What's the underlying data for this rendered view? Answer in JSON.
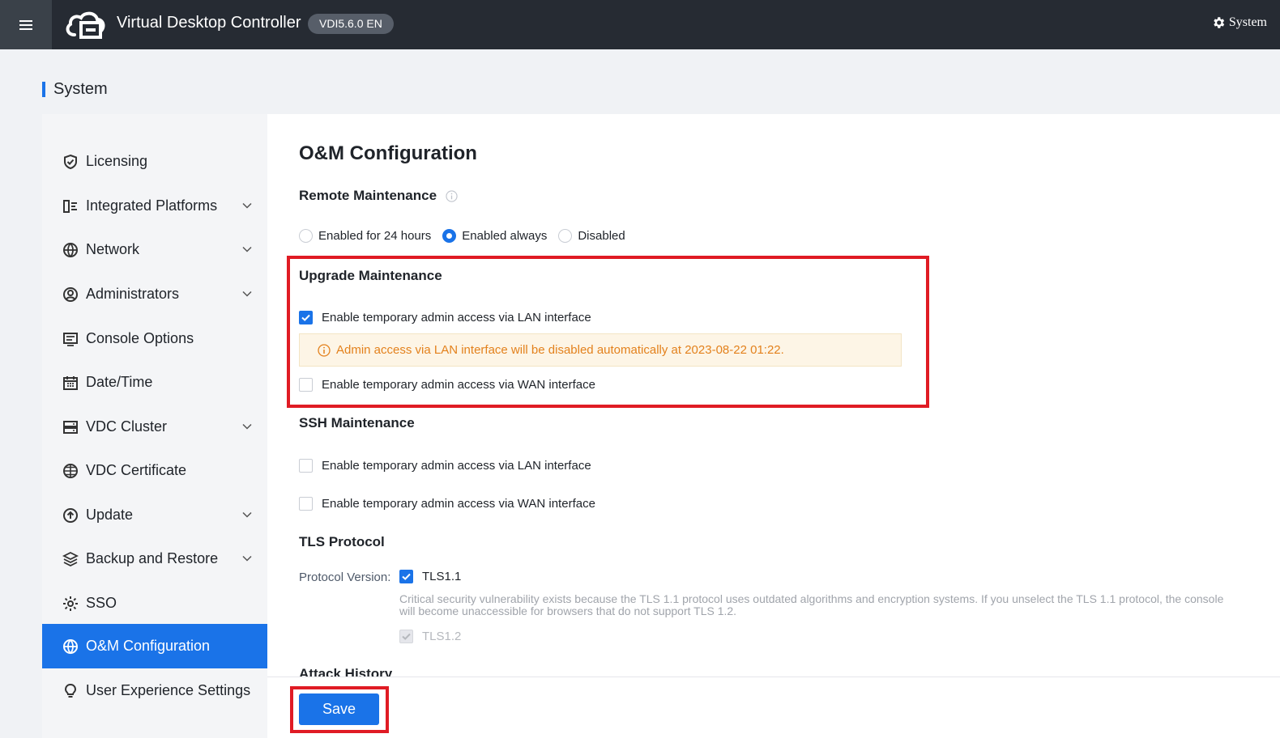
{
  "topbar": {
    "app_title": "Virtual Desktop Controller",
    "version": "VDI5.6.0 EN",
    "system_menu_label": "System"
  },
  "page": {
    "heading": "System",
    "accent_color": "#1a73e8"
  },
  "sidebar": {
    "items": [
      {
        "label": "Licensing",
        "icon": "shield-check-icon",
        "expandable": false
      },
      {
        "label": "Integrated Platforms",
        "icon": "platform-icon",
        "expandable": true
      },
      {
        "label": "Network",
        "icon": "globe-icon",
        "expandable": true
      },
      {
        "label": "Administrators",
        "icon": "user-circle-icon",
        "expandable": true
      },
      {
        "label": "Console Options",
        "icon": "console-icon",
        "expandable": false
      },
      {
        "label": "Date/Time",
        "icon": "calendar-icon",
        "expandable": false
      },
      {
        "label": "VDC Cluster",
        "icon": "server-icon",
        "expandable": true
      },
      {
        "label": "VDC Certificate",
        "icon": "certificate-globe-icon",
        "expandable": false
      },
      {
        "label": "Update",
        "icon": "upload-circle-icon",
        "expandable": true
      },
      {
        "label": "Backup and Restore",
        "icon": "layers-icon",
        "expandable": true
      },
      {
        "label": "SSO",
        "icon": "sso-gear-icon",
        "expandable": false
      },
      {
        "label": "O&M Configuration",
        "icon": "globe-icon",
        "expandable": false,
        "active": true
      },
      {
        "label": "User Experience Settings",
        "icon": "lightbulb-icon",
        "expandable": false
      }
    ]
  },
  "main": {
    "title": "O&M Configuration",
    "remote": {
      "heading": "Remote Maintenance",
      "options": [
        "Enabled for 24 hours",
        "Enabled always",
        "Disabled"
      ],
      "selected": "Enabled always"
    },
    "upgrade": {
      "heading": "Upgrade Maintenance",
      "lan_label": "Enable temporary admin access via LAN interface",
      "lan_checked": true,
      "warning": "Admin access via LAN interface will be disabled automatically at 2023-08-22 01:22.",
      "wan_label": "Enable temporary admin access via WAN interface",
      "wan_checked": false
    },
    "ssh": {
      "heading": "SSH Maintenance",
      "lan_label": "Enable temporary admin access via LAN interface",
      "lan_checked": false,
      "wan_label": "Enable temporary admin access via WAN interface",
      "wan_checked": false
    },
    "tls": {
      "heading": "TLS Protocol",
      "protocol_label": "Protocol Version:",
      "tls11_label": "TLS1.1",
      "tls11_checked": true,
      "tls11_note": "Critical security vulnerability exists because the TLS 1.1 protocol uses outdated algorithms and encryption systems. If you unselect the TLS 1.1 protocol, the console will become unaccessible for browsers that do not support TLS 1.2.",
      "tls12_label": "TLS1.2",
      "tls12_checked": true,
      "tls12_disabled": true
    },
    "attack_history_heading": "Attack History",
    "save_label": "Save"
  },
  "colors": {
    "topbar_bg": "#262b33",
    "primary": "#1a73e8",
    "warning_text": "#e3811c",
    "highlight_frame": "#e01b24"
  }
}
